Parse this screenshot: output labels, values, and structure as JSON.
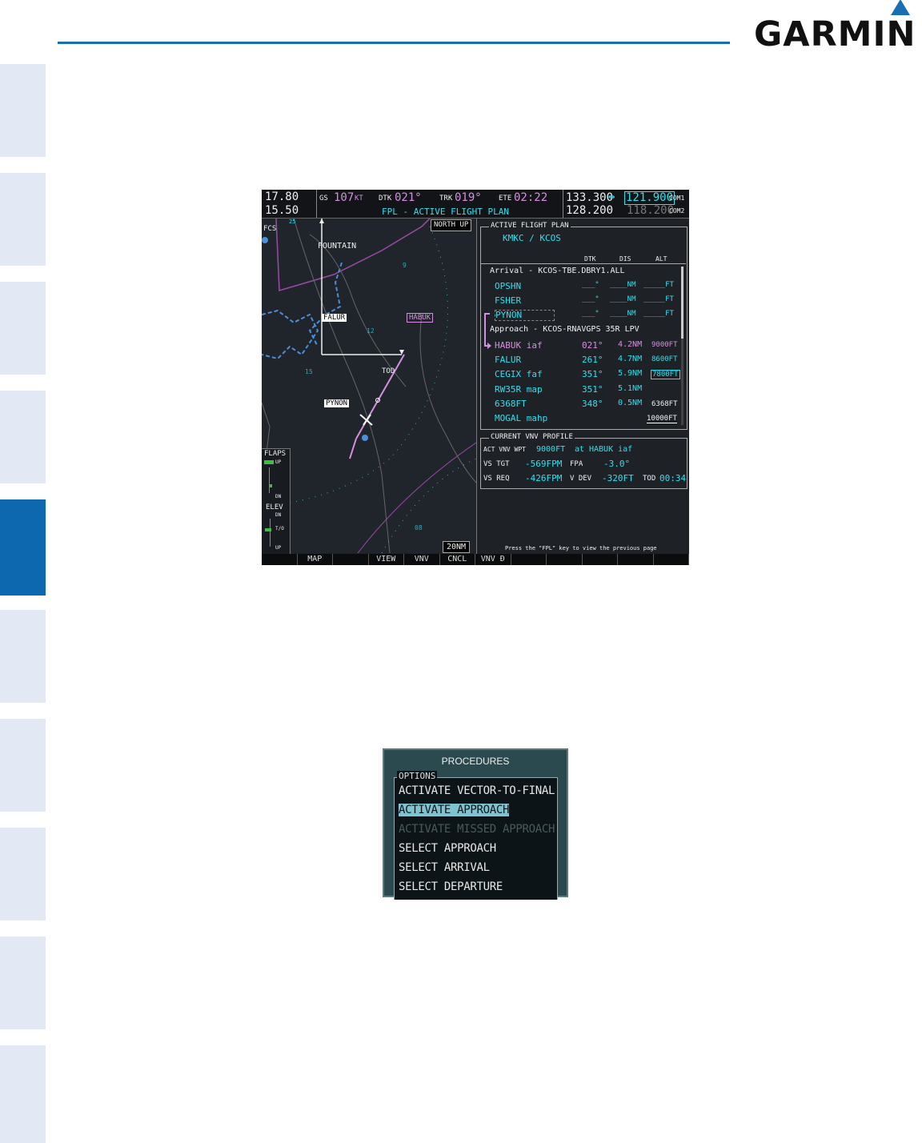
{
  "brand": {
    "logo_text": "GARMIN",
    "accent": "#1a6fb3"
  },
  "mfd": {
    "top_left": {
      "freq1": "17.80",
      "freq2": "15.50"
    },
    "fields": {
      "gs_label": "GS",
      "gs_value": "107",
      "gs_unit": "KT",
      "dtk_label": "DTK",
      "dtk_value": "021°",
      "trk_label": "TRK",
      "trk_value": "019°",
      "ete_label": "ETE",
      "ete_value": "02:22",
      "page_title": "FPL - ACTIVE FLIGHT PLAN"
    },
    "com": {
      "active1": "133.300",
      "arrow": "↔",
      "standby1": "121.900",
      "label1": "COM1",
      "active2": "128.200",
      "standby2": "118.200",
      "label2": "COM2"
    },
    "map": {
      "orientation": "NORTH UP",
      "range": "20NM",
      "labels": {
        "fcs": "FCS",
        "fountain": "FOUNTAIN",
        "falur": "FALUR",
        "habuk": "HABUK",
        "pynon": "PYNON",
        "tod": "TOD",
        "n9": "9",
        "n12": "12",
        "n15": "15",
        "n08": "08",
        "n25": "25"
      }
    },
    "flaps": {
      "title": "FLAPS",
      "up": "UP",
      "dn": "DN",
      "elev": "ELEV",
      "elev_dn": "DN",
      "to": "T/O",
      "elev_up": "UP"
    },
    "fpl": {
      "header": "ACTIVE FLIGHT PLAN",
      "route": "KMKC / KCOS",
      "columns": [
        "DTK",
        "DIS",
        "ALT"
      ],
      "arrival_label": "Arrival - KCOS-TBE.DBRY1.ALL",
      "arrival_rows": [
        {
          "wpt": "OPSHN",
          "dtk": "___°",
          "dis": "____NM",
          "alt": "_____FT"
        },
        {
          "wpt": "FSHER",
          "dtk": "___°",
          "dis": "____NM",
          "alt": "_____FT"
        },
        {
          "wpt": "PYNON",
          "dtk": "___°",
          "dis": "____NM",
          "alt": "_____FT"
        }
      ],
      "approach_label": "Approach - KCOS-RNAVGPS 35R LPV",
      "approach_rows": [
        {
          "wpt": "HABUK iaf",
          "dtk": "021°",
          "dis": "4.2NM",
          "alt": "9000FT"
        },
        {
          "wpt": "FALUR",
          "dtk": "261°",
          "dis": "4.7NM",
          "alt": "8600FT"
        },
        {
          "wpt": "CEGIX faf",
          "dtk": "351°",
          "dis": "5.9NM",
          "alt": "7800FT"
        },
        {
          "wpt": "RW35R map",
          "dtk": "351°",
          "dis": "5.1NM",
          "alt": ""
        },
        {
          "wpt": "6368FT",
          "dtk": "348°",
          "dis": "0.5NM",
          "alt": "6368FT"
        },
        {
          "wpt": "MOGAL mahp",
          "dtk": "",
          "dis": "",
          "alt": "10000FT"
        }
      ]
    },
    "vnv": {
      "header": "CURRENT VNV PROFILE",
      "act_label": "ACT VNV WPT",
      "act_alt": "9000FT",
      "act_at": "at",
      "act_wpt": "HABUK iaf",
      "vstgt_label": "VS TGT",
      "vstgt": "-569FPM",
      "fpa_label": "FPA",
      "fpa": "-3.0°",
      "vsreq_label": "VS REQ",
      "vsreq": "-426FPM",
      "vdev_label": "V DEV",
      "vdev": "-320FT",
      "tod_label": "TOD",
      "tod": "00:34"
    },
    "hint": "Press the \"FPL\" key to view the previous page",
    "softkeys": [
      "",
      "MAP",
      "",
      "VIEW",
      "VNV PROF",
      "CNCL VNV",
      "VNV Ð",
      "",
      "",
      "",
      "",
      ""
    ]
  },
  "procedures": {
    "title": "PROCEDURES",
    "options_label": "OPTIONS",
    "items": [
      "ACTIVATE VECTOR-TO-FINAL",
      "ACTIVATE APPROACH",
      "ACTIVATE MISSED APPROACH",
      "SELECT APPROACH",
      "SELECT ARRIVAL",
      "SELECT DEPARTURE"
    ],
    "selected": "ACTIVATE APPROACH",
    "disabled": "ACTIVATE MISSED APPROACH"
  }
}
